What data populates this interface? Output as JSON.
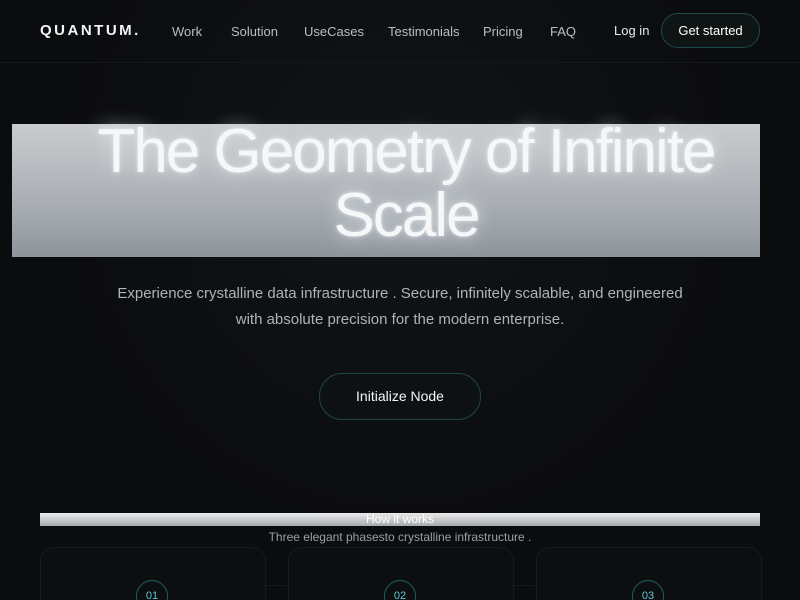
{
  "brand": {
    "logo": "QUANTUM."
  },
  "nav": {
    "links": [
      "Work",
      "Solution",
      "UseCases",
      "Testimonials",
      "Pricing",
      "FAQ"
    ],
    "login": "Log in",
    "cta": "Get started"
  },
  "hero": {
    "title_line1": "The Geometry of Infinite",
    "title_line2": "Scale",
    "subtitle_line1": "Experience crystalline data infrastructure . Secure, infinitely scalable, and engineered",
    "subtitle_line2": "with absolute precision for the modern enterprise.",
    "cta": "Initialize Node"
  },
  "how": {
    "label": "How it works",
    "subtitle": "Three elegant phasesto crystalline infrastructure .",
    "steps": [
      "01",
      "02",
      "03"
    ]
  },
  "colors": {
    "background": "#0b0c0e",
    "accent": "#5fc8d1",
    "button_border": "#1f4a4b"
  }
}
